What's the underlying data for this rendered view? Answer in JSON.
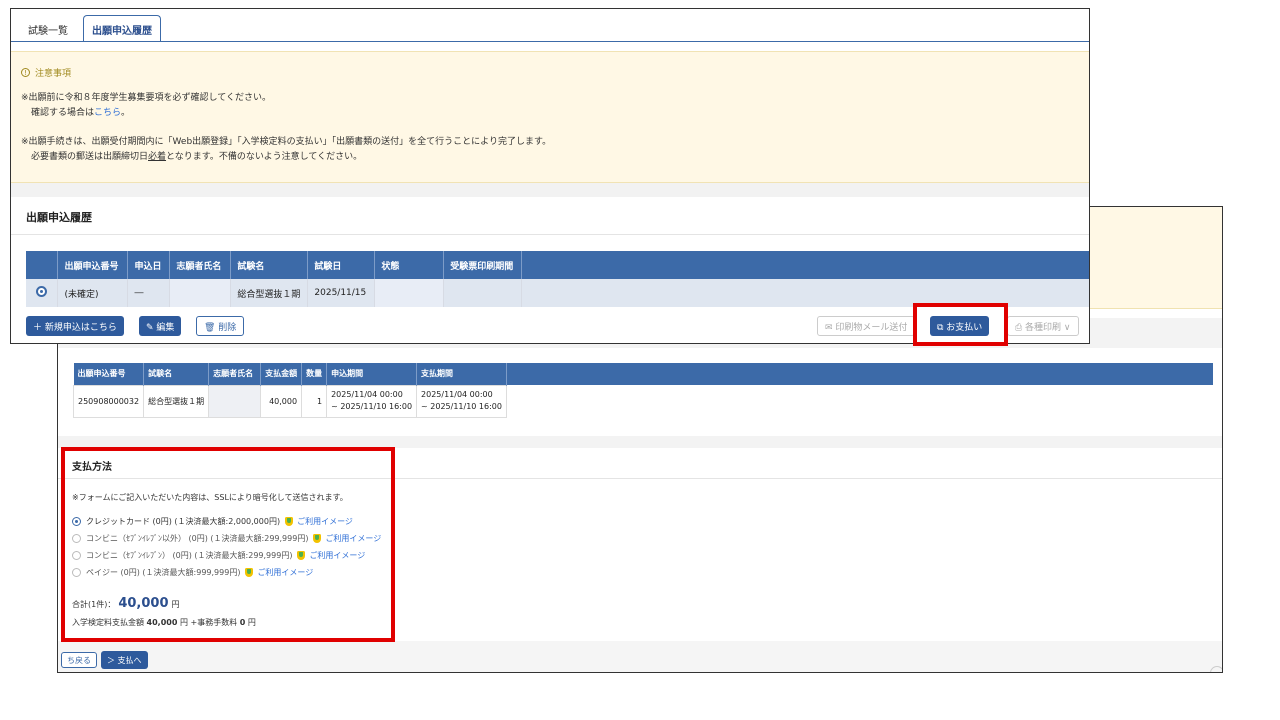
{
  "back": {
    "table": {
      "headers": [
        "出願申込番号",
        "試験名",
        "志願者氏名",
        "支払金額",
        "数量",
        "申込期間",
        "支払期間"
      ],
      "row": {
        "number": "250908000032",
        "exam": "総合型選抜１期",
        "name": "",
        "amount": "40,000",
        "qty": "1",
        "apply_period_1": "2025/11/04 00:00",
        "apply_period_2": "~ 2025/11/10 16:00",
        "pay_period_1": "2025/11/04 00:00",
        "pay_period_2": "~ 2025/11/10 16:00"
      }
    },
    "payment": {
      "title": "支払方法",
      "note": "※フォームにご記入いただいた内容は、SSLにより暗号化して送信されます。",
      "usage_link": "ご利用イメージ",
      "options": [
        {
          "label": "クレジットカード (0円) (１決済最大額:2,000,000円)",
          "selected": true
        },
        {
          "label": "コンビニ（ｾﾌﾞﾝｲﾚﾌﾞﾝ以外） (0円) (１決済最大額:299,999円)",
          "selected": false
        },
        {
          "label": "コンビニ（ｾﾌﾞﾝｲﾚﾌﾞﾝ） (0円) (１決済最大額:299,999円)",
          "selected": false
        },
        {
          "label": "ペイジー (0円) (１決済最大額:999,999円)",
          "selected": false
        }
      ],
      "total_label": "合計(1件)：",
      "total_value": "40,000",
      "total_unit": "円",
      "breakdown_prefix": "入学検定料支払金額",
      "breakdown_amount": "40,000",
      "breakdown_mid": "円 +事務手数料",
      "breakdown_fee": "0",
      "breakdown_suffix": "円"
    },
    "buttons": {
      "back": "ち戻る",
      "pay": "＞ 支払へ"
    }
  },
  "front": {
    "tabs": [
      "試験一覧",
      "出願申込履歴"
    ],
    "notice": {
      "title": "注意事項",
      "line1": "※出願前に令和８年度学生募集要項を必ず確認してください。",
      "line2_prefix": "確認する場合は",
      "line2_link": "こちら",
      "line2_suffix": "。",
      "line3": "※出願手続きは、出願受付期間内に「Web出願登録」「入学検定料の支払い」「出願書類の送付」を全て行うことにより完了します。",
      "line4_prefix": "必要書類の郵送は出願締切日",
      "line4_underlined": "必着",
      "line4_suffix": "となります。不備のないよう注意してください。"
    },
    "section_title": "出願申込履歴",
    "table": {
      "headers": [
        "出願申込番号",
        "申込日",
        "志願者氏名",
        "試験名",
        "試験日",
        "状態",
        "受験票印刷期間"
      ],
      "row": {
        "number": "(未確定)",
        "date": "―",
        "name": "",
        "exam": "総合型選抜１期",
        "exam_date": "2025/11/15",
        "status": "",
        "print_period": ""
      }
    },
    "buttons": {
      "new": "＋ 新規申込はこちら",
      "edit": "✎ 編集",
      "delete": "🗑 削除",
      "mail": "✉ 印刷物メール送付",
      "pay": "⧉ お支払い",
      "print": "⎙ 各種印刷 ∨"
    }
  },
  "colors": {
    "header_blue": "#3c6aa8",
    "button_blue": "#2e5a9c",
    "notice_bg": "#fff8e5",
    "highlight_red": "#e00000"
  }
}
